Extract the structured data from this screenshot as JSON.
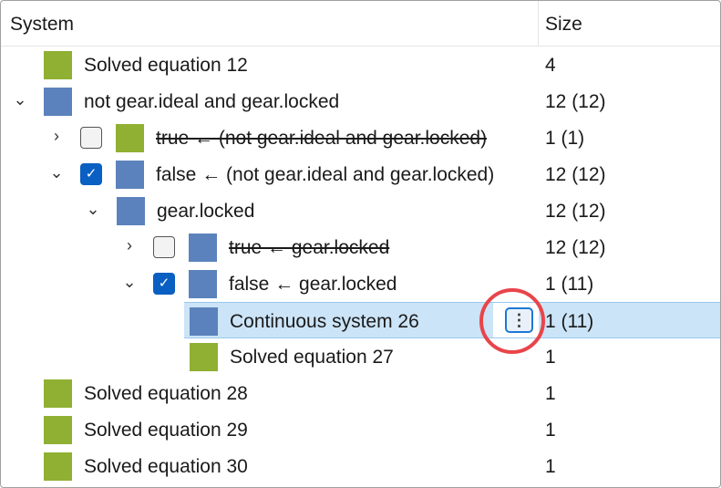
{
  "header": {
    "system": "System",
    "size": "Size"
  },
  "colors": {
    "green": "#8fb032",
    "blue": "#5b82bc",
    "selection": "#cce4f7",
    "highlight_circle": "#e8454a"
  },
  "rows": [
    {
      "label": "Solved equation 12",
      "size": "4",
      "level": 0,
      "color": "green"
    },
    {
      "label": "not gear.ideal and gear.locked",
      "size": "12 (12)",
      "level": 0,
      "color": "blue",
      "chevron": "down"
    },
    {
      "label": "true ← (not gear.ideal and gear.locked)",
      "size": "1 (1)",
      "level": 1,
      "color": "green",
      "chevron": "right",
      "checkbox": false,
      "strike": true
    },
    {
      "label": "false ← (not gear.ideal and gear.locked)",
      "size": "12 (12)",
      "level": 1,
      "color": "blue",
      "chevron": "down",
      "checkbox": true
    },
    {
      "label": "gear.locked",
      "size": "12 (12)",
      "level": 2,
      "color": "blue",
      "chevron": "down"
    },
    {
      "label": "true ← gear.locked",
      "size": "12 (12)",
      "level": 3,
      "color": "blue",
      "chevron": "right",
      "checkbox": false,
      "strike": true
    },
    {
      "label": "false ← gear.locked",
      "size": "1 (11)",
      "level": 3,
      "color": "blue",
      "chevron": "down",
      "checkbox": true
    },
    {
      "label": "Continuous system 26",
      "size": "1 (11)",
      "level": 4,
      "color": "blue",
      "selected": true
    },
    {
      "label": "Solved equation 27",
      "size": "1",
      "level": 4,
      "color": "green"
    },
    {
      "label": "Solved equation 28",
      "size": "1",
      "level": 0,
      "color": "green"
    },
    {
      "label": "Solved equation 29",
      "size": "1",
      "level": 0,
      "color": "green"
    },
    {
      "label": "Solved equation 30",
      "size": "1",
      "level": 0,
      "color": "green"
    }
  ],
  "more_button": {
    "icon": "vertical-ellipsis-icon",
    "glyph": "⋮"
  }
}
